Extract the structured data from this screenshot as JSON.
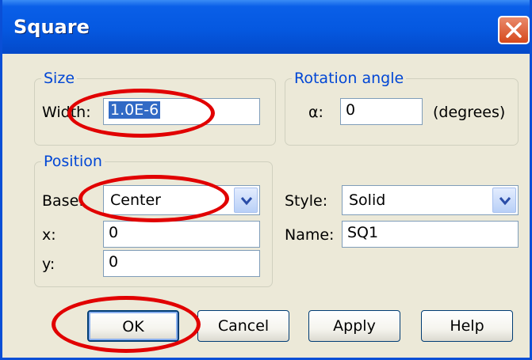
{
  "window": {
    "title": "Square"
  },
  "size": {
    "legend": "Size",
    "width_label": "Width:",
    "width_value": "1.0E-6"
  },
  "rotation": {
    "legend": "Rotation angle",
    "alpha_label": "α:",
    "alpha_value": "0",
    "unit": "(degrees)"
  },
  "position": {
    "legend": "Position",
    "base_label": "Base:",
    "base_value": "Center",
    "x_label": "x:",
    "x_value": "0",
    "y_label": "y:",
    "y_value": "0"
  },
  "style": {
    "style_label": "Style:",
    "style_value": "Solid",
    "name_label": "Name:",
    "name_value": "SQ1"
  },
  "buttons": {
    "ok": "OK",
    "cancel": "Cancel",
    "apply": "Apply",
    "help": "Help"
  },
  "annotation_color": "#e10000"
}
